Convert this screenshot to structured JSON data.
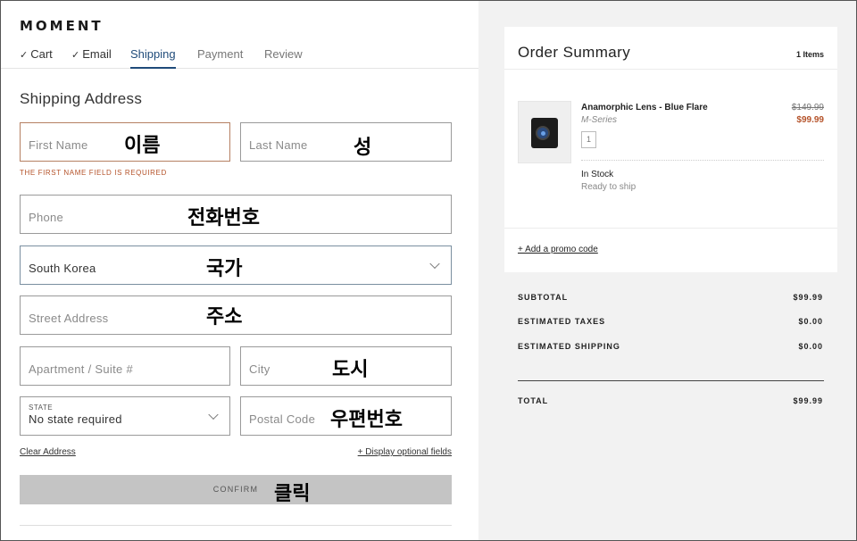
{
  "brand": {
    "logo": "MOMENT"
  },
  "steps": [
    {
      "label": "Cart",
      "done": true
    },
    {
      "label": "Email",
      "done": true
    },
    {
      "label": "Shipping",
      "active": true
    },
    {
      "label": "Payment"
    },
    {
      "label": "Review"
    }
  ],
  "check_glyph": "✓",
  "shipping": {
    "title": "Shipping Address",
    "first_name": {
      "placeholder": "First Name",
      "annotation": "이름"
    },
    "last_name": {
      "placeholder": "Last Name",
      "annotation": "성"
    },
    "error_message": "THE FIRST NAME FIELD IS REQUIRED",
    "phone": {
      "placeholder": "Phone",
      "annotation": "전화번호"
    },
    "country": {
      "value": "South Korea",
      "annotation": "국가"
    },
    "street": {
      "placeholder": "Street Address",
      "annotation": "주소"
    },
    "apartment": {
      "placeholder": "Apartment / Suite #"
    },
    "city": {
      "placeholder": "City",
      "annotation": "도시"
    },
    "state": {
      "label": "STATE",
      "value": "No state required"
    },
    "postal": {
      "placeholder": "Postal Code",
      "annotation": "우편번호"
    },
    "clear_address": "Clear Address",
    "display_optional": "+ Display optional fields",
    "confirm": {
      "label": "CONFIRM",
      "annotation": "클릭"
    }
  },
  "summary": {
    "title": "Order Summary",
    "items_count": "1 Items",
    "product": {
      "name": "Anamorphic Lens - Blue Flare",
      "series": "M-Series",
      "quantity": "1",
      "price_original": "$149.99",
      "price_sale": "$99.99",
      "stock": "In Stock",
      "ready": "Ready to ship"
    },
    "promo": "+ Add a promo code",
    "subtotal": {
      "label": "SUBTOTAL",
      "value": "$99.99"
    },
    "taxes": {
      "label": "ESTIMATED TAXES",
      "value": "$0.00"
    },
    "shipping": {
      "label": "ESTIMATED SHIPPING",
      "value": "$0.00"
    },
    "total": {
      "label": "TOTAL",
      "value": "$99.99"
    }
  },
  "colors": {
    "accent": "#1f4b7a",
    "error": "#b5532a",
    "confirm_bg": "#c4c4c4",
    "summary_bg": "#f2f2f2"
  }
}
